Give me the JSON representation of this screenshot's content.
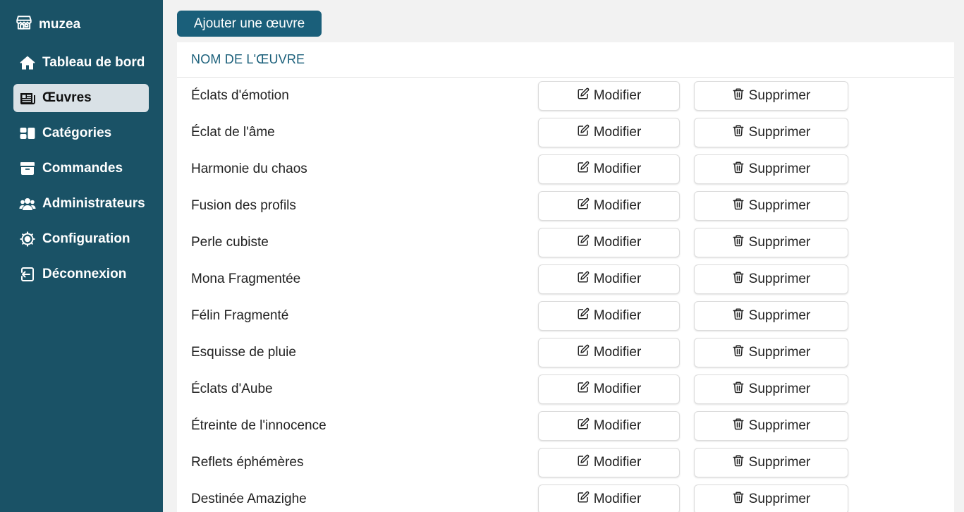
{
  "brand": {
    "name": "muzea",
    "icon": "shop-icon"
  },
  "sidebar": {
    "items": [
      {
        "label": "Tableau de bord",
        "icon": "home-icon",
        "active": false
      },
      {
        "label": "Œuvres",
        "icon": "newspaper-icon",
        "active": true
      },
      {
        "label": "Catégories",
        "icon": "category-blocks-icon",
        "active": false
      },
      {
        "label": "Commandes",
        "icon": "archive-box-icon",
        "active": false
      },
      {
        "label": "Administrateurs",
        "icon": "users-icon",
        "active": false
      },
      {
        "label": "Configuration",
        "icon": "settings-gear-icon",
        "active": false
      },
      {
        "label": "Déconnexion",
        "icon": "logout-icon",
        "active": false
      }
    ]
  },
  "toolbar": {
    "add_label": "Ajouter une œuvre"
  },
  "table": {
    "header": "NOM DE L'ŒUVRE",
    "edit_label": "Modifier",
    "delete_label": "Supprimer",
    "rows": [
      "Éclats d'émotion",
      "Éclat de l'âme",
      "Harmonie du chaos",
      "Fusion des profils",
      "Perle cubiste",
      "Mona Fragmentée",
      "Félin Fragmenté",
      "Esquisse de pluie",
      "Éclats d'Aube",
      "Étreinte de l'innocence",
      "Reflets éphémères",
      "Destinée Amazighe"
    ]
  },
  "colors": {
    "sidebar": "#1a5266",
    "active_item": "#d9e1e6",
    "primary_button": "#1a5f7a",
    "header_text": "#1a5f7a"
  }
}
